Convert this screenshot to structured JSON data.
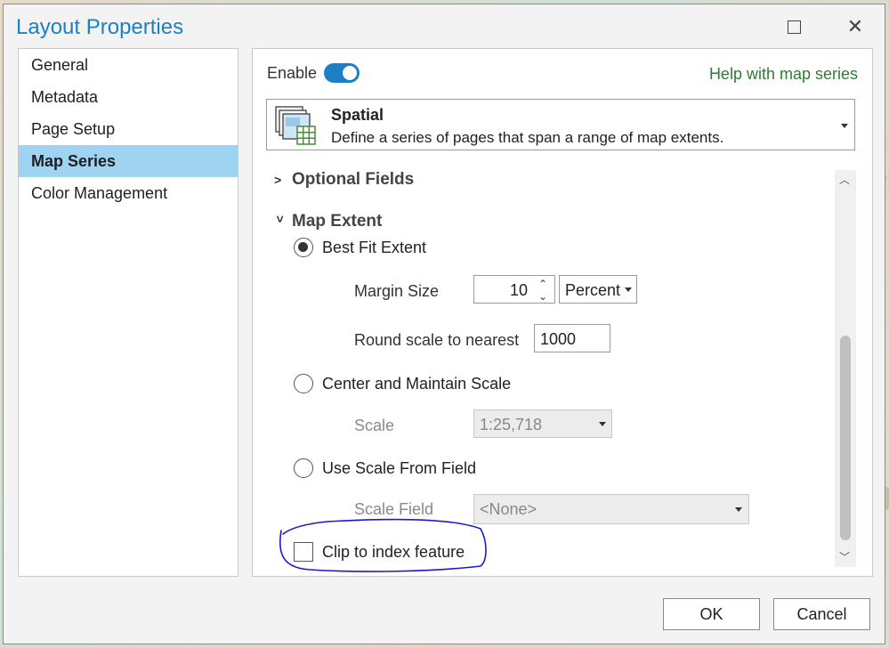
{
  "window": {
    "title": "Layout Properties",
    "maximize_icon": "maximize-icon",
    "close_glyph": "✕"
  },
  "sidebar": {
    "items": [
      {
        "label": "General"
      },
      {
        "label": "Metadata"
      },
      {
        "label": "Page Setup"
      },
      {
        "label": "Map Series",
        "selected": true
      },
      {
        "label": "Color Management"
      }
    ]
  },
  "header": {
    "enable_label": "Enable",
    "enable_on": true,
    "help_link": "Help with map series"
  },
  "series_type": {
    "name": "Spatial",
    "description": "Define a series of pages that span a range of map extents."
  },
  "optional_fields": {
    "label": "Optional Fields",
    "expanded": false
  },
  "map_extent": {
    "label": "Map Extent",
    "expanded": true,
    "best_fit": {
      "label": "Best Fit Extent",
      "selected": true,
      "margin_size_label": "Margin Size",
      "margin_size_value": "10",
      "margin_unit": "Percent",
      "round_scale_label": "Round scale to nearest",
      "round_scale_value": "1000"
    },
    "center_maintain": {
      "label": "Center and Maintain Scale",
      "selected": false,
      "scale_label": "Scale",
      "scale_value": "1:25,718"
    },
    "scale_from_field": {
      "label": "Use Scale From Field",
      "selected": false,
      "scale_field_label": "Scale Field",
      "scale_field_value": "<None>"
    },
    "clip_to_index": {
      "label": "Clip to index feature",
      "checked": false
    }
  },
  "buttons": {
    "ok": "OK",
    "cancel": "Cancel"
  },
  "colors": {
    "accent": "#1d7fc4",
    "help_link": "#2e7d32",
    "selected_sidebar": "#9fd3f2",
    "annotation_ink": "#1a1acc"
  }
}
